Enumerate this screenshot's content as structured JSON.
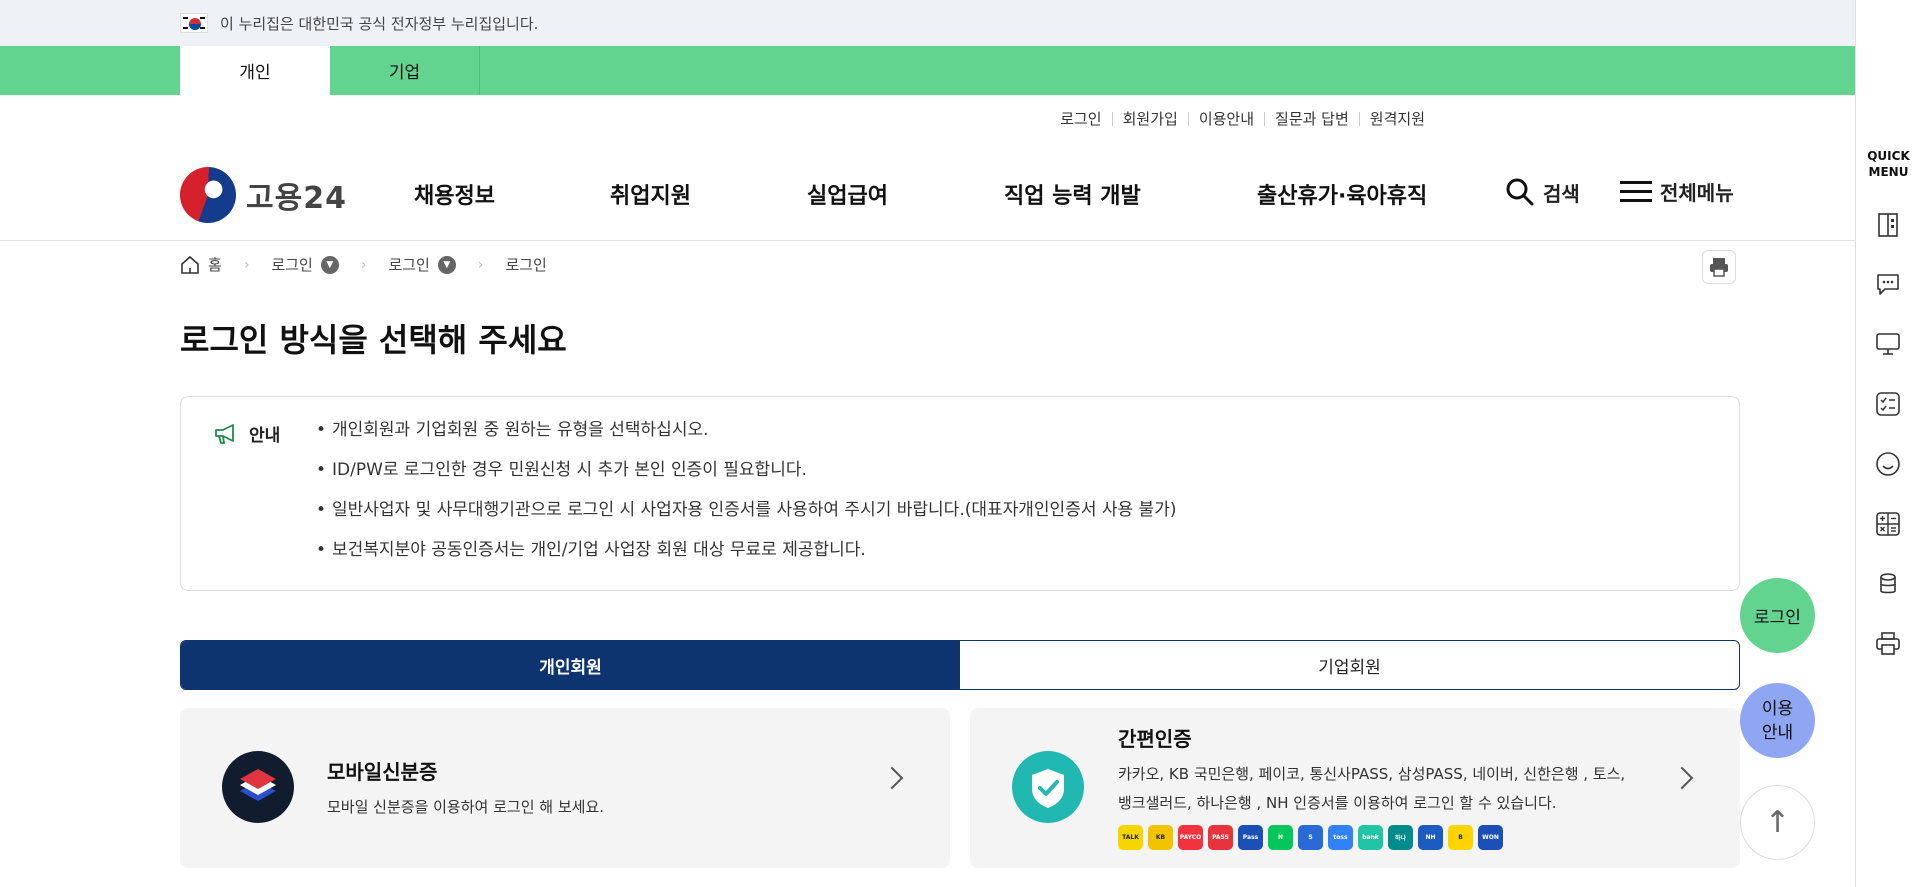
{
  "gov_banner": {
    "text": "이 누리집은 대한민국 공식 전자정부 누리집입니다."
  },
  "top_tabs": [
    "개인",
    "기업"
  ],
  "utility_links": [
    "로그인",
    "회원가입",
    "이용안내",
    "질문과 답변",
    "원격지원"
  ],
  "logo": {
    "text": "고용24"
  },
  "gnb": [
    "채용정보",
    "취업지원",
    "실업급여",
    "직업 능력 개발",
    "출산휴가·육아휴직"
  ],
  "search_label": "검색",
  "menu_label": "전체메뉴",
  "breadcrumb": [
    "홈",
    "로그인",
    "로그인",
    "로그인"
  ],
  "page_title": "로그인 방식을 선택해 주세요",
  "notice": {
    "label": "안내",
    "items": [
      "개인회원과 기업회원 중 원하는 유형을 선택하십시오.",
      "ID/PW로 로그인한 경우 민원신청 시 추가 본인 인증이 필요합니다.",
      "일반사업자 및 사무대행기관으로 로그인 시 사업자용 인증서를 사용하여 주시기 바랍니다.(대표자개인인증서 사용 불가)",
      "보건복지분야 공동인증서는 개인/기업 사업장 회원 대상 무료로 제공합니다."
    ]
  },
  "member_tabs": [
    "개인회원",
    "기업회원"
  ],
  "cards": [
    {
      "title": "모바일신분증",
      "desc": "모바일 신분증을 이용하여 로그인 해 보세요."
    },
    {
      "title": "간편인증",
      "desc_line1": "카카오, KB 국민은행, 페이코, 통신사PASS, 삼성PASS, 네이버, 신한은행 , 토스,",
      "desc_line2": "뱅크샐러드, 하나은행 , NH 인증서를 이용하여 로그인 할 수 있습니다."
    }
  ],
  "auth_badges": [
    {
      "label": "TALK",
      "color": "#f7d600"
    },
    {
      "label": "KB",
      "color": "#f2c300"
    },
    {
      "label": "PAYCO",
      "color": "#f3323f"
    },
    {
      "label": "PASS",
      "color": "#e8323c"
    },
    {
      "label": "Pass",
      "color": "#1a4fb5"
    },
    {
      "label": "N",
      "color": "#03c75a"
    },
    {
      "label": "S",
      "color": "#2a6ad6"
    },
    {
      "label": "toss",
      "color": "#3182f6"
    },
    {
      "label": "bank",
      "color": "#20c5a6"
    },
    {
      "label": "하나",
      "color": "#008c8c"
    },
    {
      "label": "NH",
      "color": "#1b5cc2"
    },
    {
      "label": "B",
      "color": "#ffd400"
    },
    {
      "label": "WON",
      "color": "#1a4fb5"
    }
  ],
  "floating": {
    "login": "로그인",
    "guide_line1": "이용",
    "guide_line2": "안내",
    "top": "↑"
  },
  "quick_menu": {
    "title_line1": "QUICK",
    "title_line2": "MENU"
  },
  "colors": {
    "green": "#62d48f",
    "navy": "#0e3470",
    "teal": "#20b8b0",
    "guide": "#8fa6f2"
  }
}
